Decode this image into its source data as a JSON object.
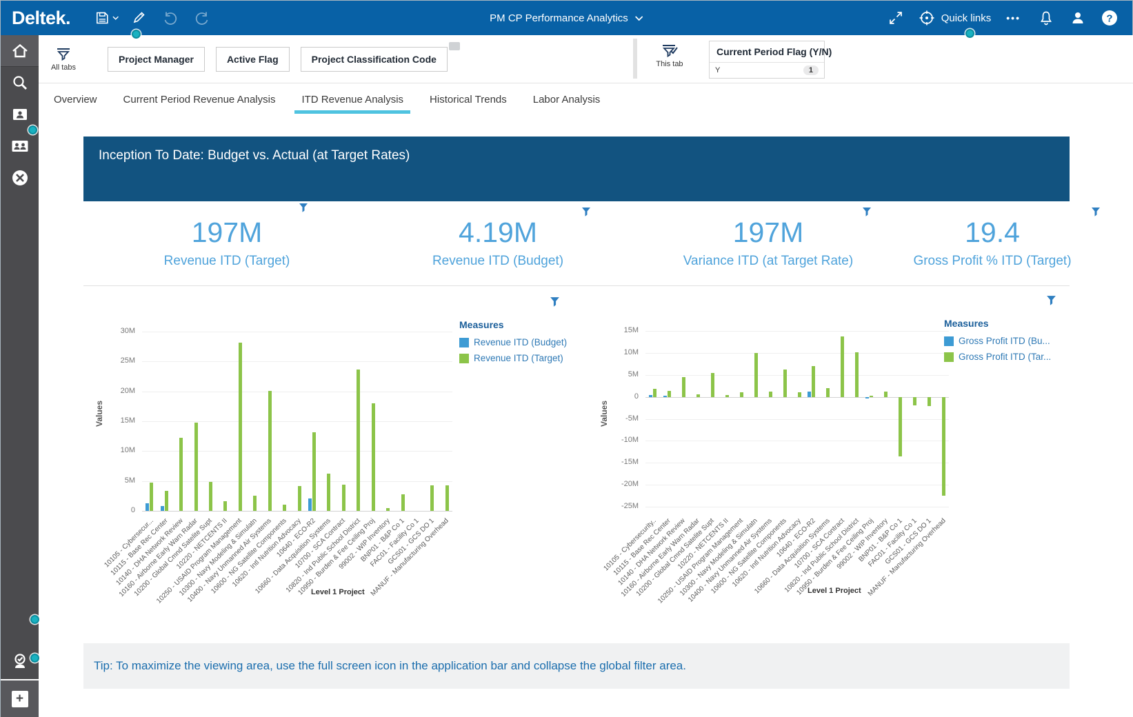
{
  "topbar": {
    "logo": "Deltek.",
    "app_title": "PM CP Performance Analytics",
    "quick_links_label": "Quick links"
  },
  "filterbar": {
    "all_tabs_label": "All tabs",
    "buttons": [
      "Project Manager",
      "Active Flag",
      "Project Classification Code"
    ],
    "this_tab_label": "This tab",
    "tab_filter": {
      "title": "Current Period Flag (Y/N)",
      "value": "Y",
      "count": "1"
    }
  },
  "tabs": [
    {
      "label": "Overview"
    },
    {
      "label": "Current Period Revenue Analysis"
    },
    {
      "label": "ITD Revenue Analysis"
    },
    {
      "label": "Historical Trends"
    },
    {
      "label": "Labor Analysis"
    }
  ],
  "banner": {
    "title": "Inception To Date:  Budget vs. Actual (at Target Rates)"
  },
  "kpis": [
    {
      "value": "197M",
      "label": "Revenue ITD (Target)"
    },
    {
      "value": "4.19M",
      "label": "Revenue ITD (Budget)"
    },
    {
      "value": "197M",
      "label": "Variance ITD (at Target Rate)"
    },
    {
      "value": "19.4",
      "label": "Gross Profit % ITD (Target)"
    }
  ],
  "tip": {
    "text": "Tip:  To maximize the viewing area, use the full screen icon in the application bar and collapse the global filter area."
  },
  "colors": {
    "topbar": "#0861a6",
    "banner": "#125380",
    "kpi_text": "#4fa3db",
    "active_tab_underline": "#4fc3e0",
    "budget_bar": "#3d9bd4",
    "target_bar": "#8cc449",
    "legend_text": "#2e79b5"
  },
  "chart_data": [
    {
      "type": "bar",
      "title": "",
      "xlabel": "Level 1 Project",
      "ylabel": "Values",
      "ylim": [
        0,
        33
      ],
      "yticks": [
        0,
        5,
        10,
        15,
        20,
        25,
        30
      ],
      "ytick_labels": [
        "0",
        "5M",
        "10M",
        "15M",
        "20M",
        "25M",
        "30M"
      ],
      "grid": true,
      "legend_title": "Measures",
      "legend_position": "right",
      "unit": "millions",
      "categories": [
        "10105 - Cybersecur...",
        "10115 - Base Rec Center",
        "10140 - DHA Network Review",
        "10160 - Airborne Early Warn Radar",
        "10200 - Global Cmnd Satelite Supt",
        "10220 - NETCENTS II",
        "10250 - USAID Program Management",
        "10300 - Navy Modeling & Simulatn",
        "10400 - Navy Unmanned Air Systems",
        "10600 - NG Satellite Components",
        "10620 - Intl Nutrition Advocacy",
        "10640 - ECO-R2",
        "10660 - Data Acquisition Systems",
        "10700 - SCA Contract",
        "10820 - Ind Public School District",
        "10950 - Burden & Fee Ceiling Proj",
        "99002 - WIP Inventory",
        "BNP01 - B&P Co 1",
        "FAC01 - Facility Co 1",
        "GCS01 - GCS DO 1",
        "MANUF - Manufacturing Overhead"
      ],
      "series": [
        {
          "name": "Revenue ITD (Budget)",
          "color": "#3d9bd4",
          "values": [
            1.3,
            0.8,
            0,
            0,
            0,
            0,
            0,
            0,
            0,
            0,
            0,
            2.1,
            0,
            0,
            0,
            0,
            0,
            0,
            0,
            0,
            0
          ]
        },
        {
          "name": "Revenue ITD (Target)",
          "color": "#8cc449",
          "values": [
            4.7,
            3.3,
            12.2,
            14.8,
            4.9,
            1.6,
            28.2,
            2.5,
            20.1,
            1.0,
            4.2,
            13.1,
            6.2,
            4.4,
            23.7,
            18.0,
            0.5,
            2.8,
            0,
            4.3,
            4.3
          ]
        }
      ]
    },
    {
      "type": "bar",
      "title": "",
      "xlabel": "Level 1 Project",
      "ylabel": "Values",
      "ylim": [
        -26,
        19
      ],
      "yticks": [
        -25,
        -20,
        -15,
        -10,
        -5,
        0,
        5,
        10,
        15
      ],
      "ytick_labels": [
        "-25M",
        "-20M",
        "-15M",
        "-10M",
        "-5M",
        "0",
        "5M",
        "10M",
        "15M"
      ],
      "grid": true,
      "legend_title": "Measures",
      "legend_position": "right",
      "unit": "millions",
      "categories": [
        "10105 - Cybersecurity..",
        "10115 - Base Rec Center",
        "10140 - DHA Network Review",
        "10160 - Airborne Early Warn Radar",
        "10200 - Global Cmnd Satelite Supt",
        "10220 - NETCENTS II",
        "10250 - USAID Program Management",
        "10300 - Navy Modeling & Simulatn",
        "10400 - Navy Unmanned Air Systems",
        "10600 - NG Satellite Components",
        "10620 - Intl Nutrition Advocacy",
        "10640 - ECO-R2",
        "10660 - Data Acquisition Systems",
        "10700 - SCA Contract",
        "10820 - Ind Public School District",
        "10950 - Burden & Fee Ceiling Proj",
        "99002 - WIP Inventory",
        "BNP01 - B&P Co 1",
        "FAC01 - Facility Co 1",
        "GCS01 - GCS DO 1",
        "MANUF - Manufacturing Overhead"
      ],
      "series": [
        {
          "name": "Gross Profit ITD (Bu...",
          "color": "#3d9bd4",
          "values": [
            0.5,
            0.3,
            0,
            0,
            0,
            0,
            0,
            0,
            0,
            0,
            0,
            1.2,
            0,
            0,
            0,
            -0.3,
            0,
            0,
            0,
            0,
            0
          ]
        },
        {
          "name": "Gross Profit ITD (Tar...",
          "color": "#8cc449",
          "values": [
            1.9,
            1.3,
            4.6,
            0.6,
            5.4,
            0.5,
            1.1,
            10.1,
            1.2,
            6.3,
            1.0,
            7.1,
            2.0,
            13.8,
            10.2,
            0.2,
            1.2,
            -13.6,
            -1.9,
            -2.1,
            -22.6
          ]
        }
      ]
    }
  ]
}
